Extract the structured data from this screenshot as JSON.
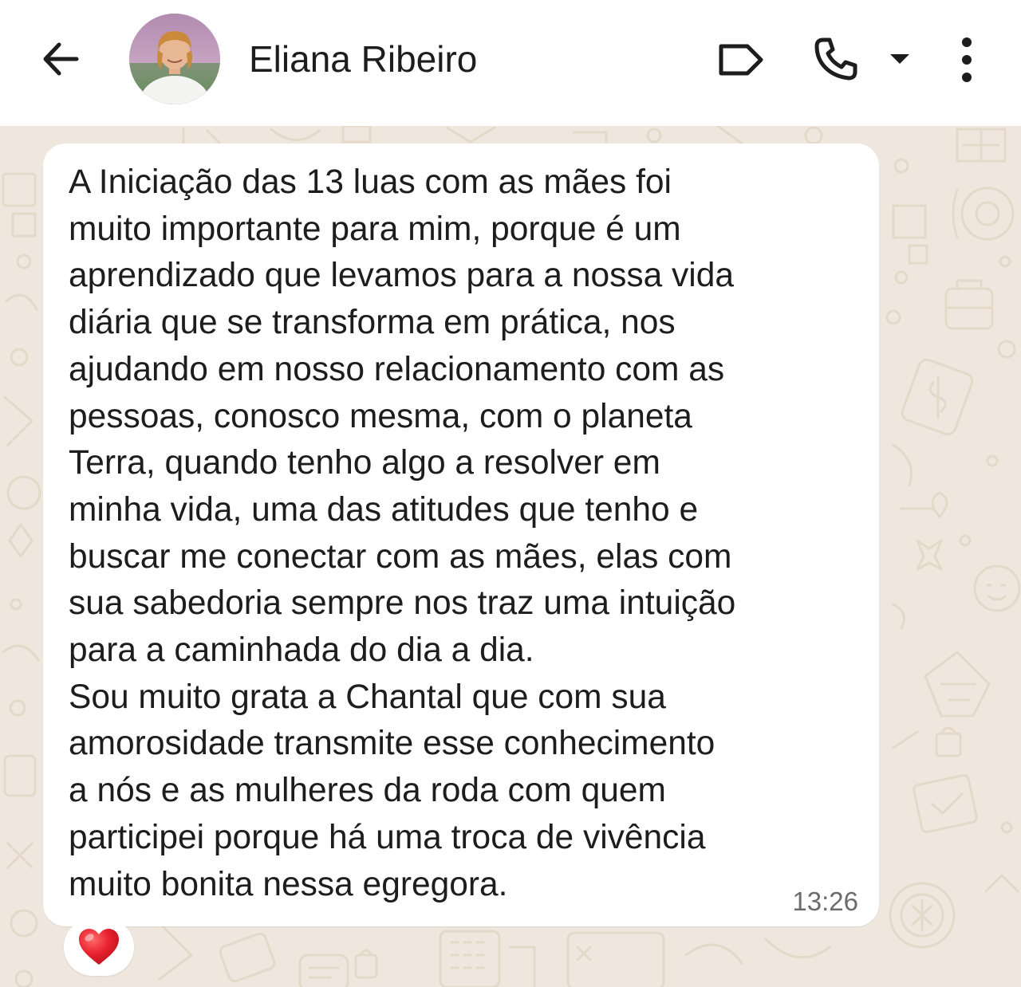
{
  "header": {
    "contact_name": "Eliana Ribeiro"
  },
  "icons": {
    "back": "arrow-left-icon",
    "label": "label-tag-icon",
    "call": "phone-icon",
    "call_dropdown": "caret-down-icon",
    "menu": "more-vertical-icon"
  },
  "message": {
    "text": "A Iniciação das 13 luas com as mães foi\nmuito importante para mim, porque é um\naprendizado que levamos para a nossa vida\ndiária que se transforma em prática, nos\najudando em nosso relacionamento com as\npessoas, conosco mesma, com o planeta\nTerra, quando tenho algo a resolver em\nminha vida, uma das atitudes que tenho e\nbuscar me conectar com as mães, elas com\nsua sabedoria sempre nos traz uma intuição\npara a caminhada do dia a dia.\nSou muito grata a Chantal que com sua\namorosidade transmite esse conhecimento\na nós e as mulheres da roda com quem\nparticipei porque há uma troca de vivência\nmuito bonita nessa egregora.",
    "time": "13:26",
    "reaction": "❤️"
  },
  "colors": {
    "chat_background": "#efe7dd",
    "bubble": "#ffffff",
    "header": "#ffffff",
    "reaction_red": "#e0202a"
  }
}
